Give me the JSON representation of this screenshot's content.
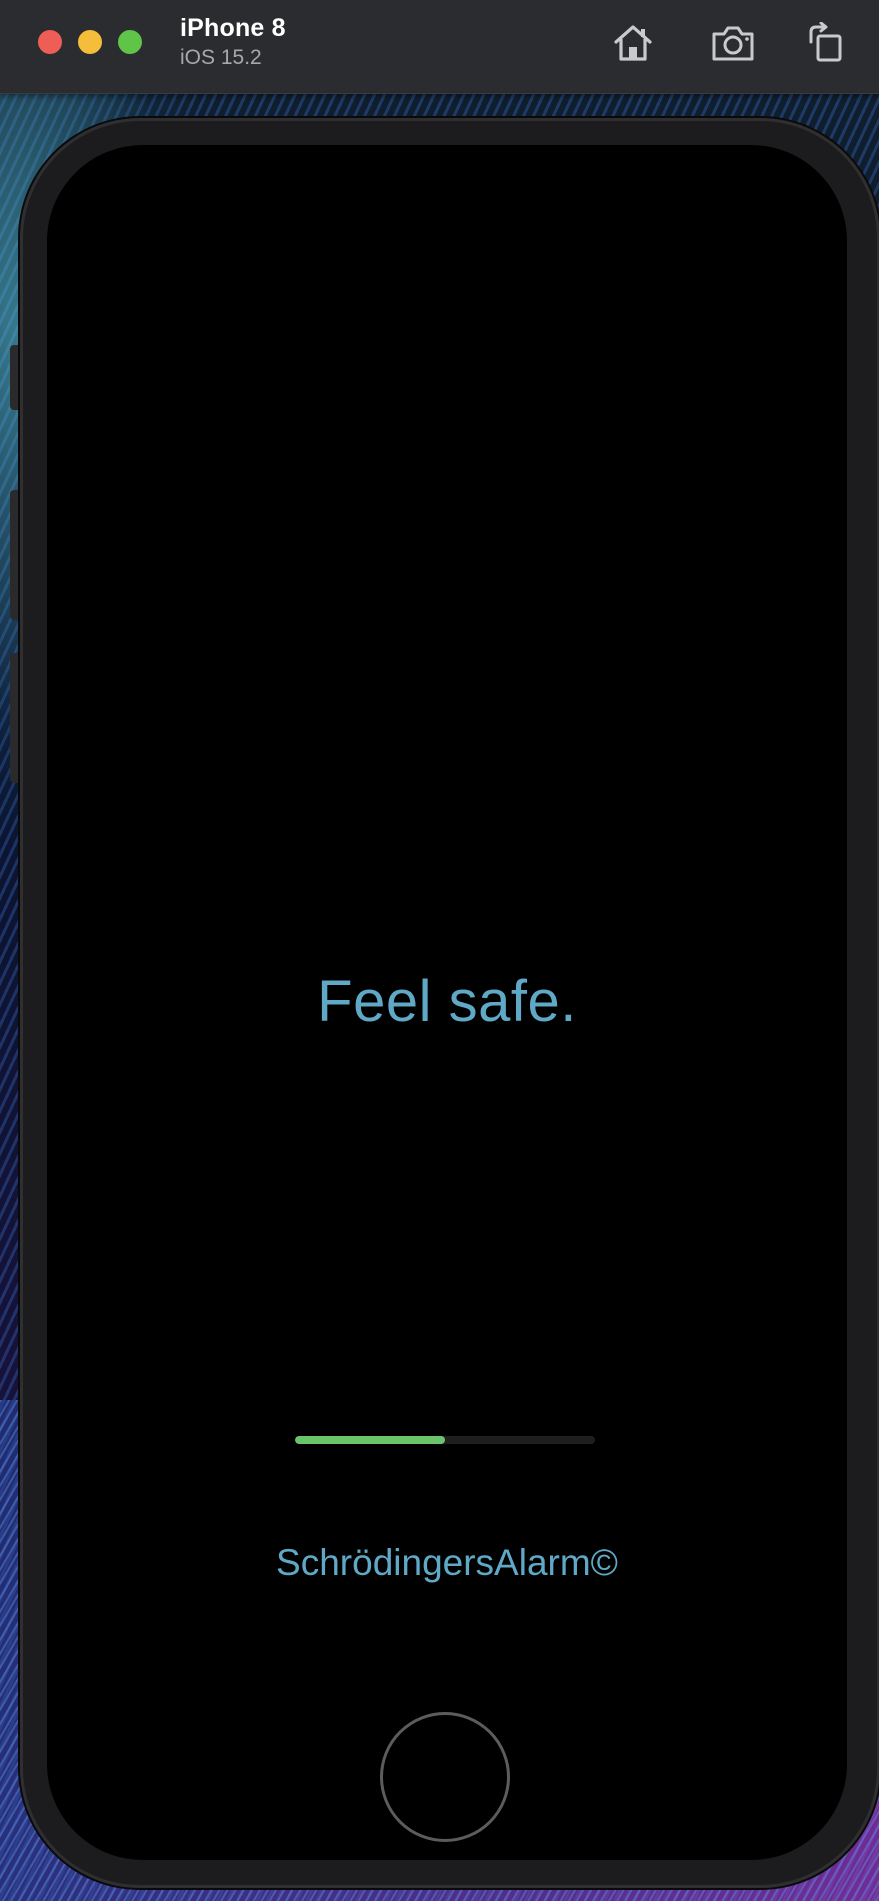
{
  "titlebar": {
    "device_name": "iPhone 8",
    "os_version": "iOS 15.2",
    "buttons": {
      "home_icon": "home-icon",
      "screenshot_icon": "screenshot-icon",
      "rotate_icon": "rotate-icon"
    }
  },
  "colors": {
    "accent_text": "#5fa9c7",
    "progress_fill": "#6cc46a",
    "progress_track": "#1f1f21",
    "traffic_close": "#ee5e57",
    "traffic_minimize": "#f4bd3a",
    "traffic_maximize": "#5fc447"
  },
  "app": {
    "tagline": "Feel safe.",
    "loading_progress": 0.5,
    "brand": "SchrödingersAlarm©"
  }
}
